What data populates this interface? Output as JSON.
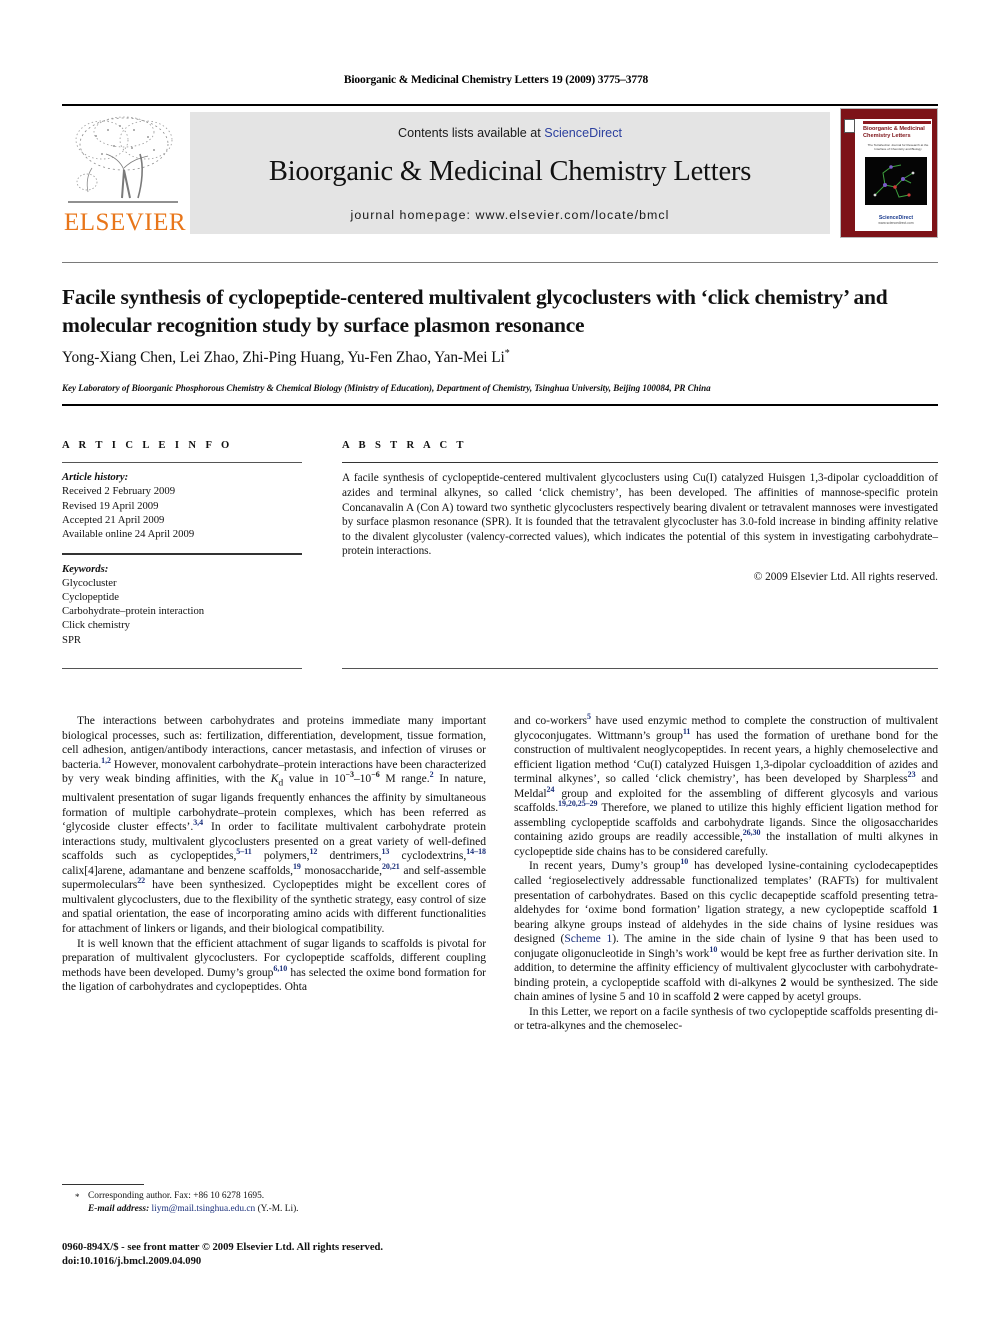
{
  "running_head": "Bioorganic & Medicinal Chemistry Letters 19 (2009) 3775–3778",
  "masthead": {
    "contents_prefix": "Contents lists available at ",
    "sciencedirect": "ScienceDirect",
    "journal_title": "Bioorganic & Medicinal Chemistry Letters",
    "homepage": "journal homepage: www.elsevier.com/locate/bmcl",
    "publisher_logo_text": "ELSEVIER",
    "cover": {
      "title": "Bioorganic & Medicinal Chemistry Letters",
      "subtitle": "The Tetrahedron Journal for Research at the Interface of Chemistry and Biology",
      "footer": "ScienceDirect",
      "footer_url": "www.sciencedirect.com",
      "border_color": "#7d1318"
    }
  },
  "article": {
    "title": "Facile synthesis of cyclopeptide-centered multivalent glycoclusters with ‘click chemistry’ and molecular recognition study by surface plasmon resonance",
    "authors": "Yong-Xiang Chen, Lei Zhao, Zhi-Ping Huang, Yu-Fen Zhao, Yan-Mei Li",
    "author_marker": "*",
    "affiliation": "Key Laboratory of Bioorganic Phosphorous Chemistry & Chemical Biology (Ministry of Education), Department of Chemistry, Tsinghua University, Beijing 100084, PR China"
  },
  "article_info": {
    "heading": "A R T I C L E   I N F O",
    "history_label": "Article history:",
    "history": [
      "Received 2 February 2009",
      "Revised 19 April 2009",
      "Accepted 21 April 2009",
      "Available online 24 April 2009"
    ],
    "keywords_label": "Keywords:",
    "keywords": [
      "Glycocluster",
      "Cyclopeptide",
      "Carbohydrate–protein interaction",
      "Click chemistry",
      "SPR"
    ]
  },
  "abstract": {
    "heading": "A B S T R A C T",
    "text": "A facile synthesis of cyclopeptide-centered multivalent glycoclusters using Cu(I) catalyzed Huisgen 1,3-dipolar cycloaddition of azides and terminal alkynes, so called ‘click chemistry’, has been developed. The affinities of mannose-specific protein Concanavalin A (Con A) toward two synthetic glycoclusters respectively bearing divalent or tetravalent mannoses were investigated by surface plasmon resonance (SPR). It is founded that the tetravalent glycocluster has 3.0-fold increase in binding affinity relative to the divalent glycoluster (valency-corrected values), which indicates the potential of this system in investigating carbohydrate–protein interactions.",
    "copyright": "© 2009 Elsevier Ltd. All rights reserved."
  },
  "body": {
    "left_paragraphs": [
      "The interactions between carbohydrates and proteins immediate many important biological processes, such as: fertilization, differentiation, development, tissue formation, cell adhesion, antigen/antibody interactions, cancer metastasis, and infection of viruses or bacteria.[1,2] However, monovalent carbohydrate–protein interactions have been characterized by very weak binding affinities, with the Kd value in 10^-3–10^-6 M range.[2] In nature, multivalent presentation of sugar ligands frequently enhances the affinity by simultaneous formation of multiple carbohydrate–protein complexes, which has been referred as ‘glycoside cluster effects’.[3,4] In order to facilitate multivalent carbohydrate protein interactions study, multivalent glycoclusters presented on a great variety of well-defined scaffolds such as cyclopeptides,[5–11] polymers,[12] dentrimers,[13] cyclodextrins,[14–18] calix[4]arene, adamantane and benzene scaffolds,[19] monosaccharide,[20,21] and self-assemble supermoleculars[22] have been synthesized. Cyclopeptides might be excellent cores of multivalent glycoclusters, due to the flexibility of the synthetic strategy, easy control of size and spatial orientation, the ease of incorporating amino acids with different functionalities for attachment of linkers or ligands, and their biological compatibility.",
      "It is well known that the efficient attachment of sugar ligands to scaffolds is pivotal for preparation of multivalent glycoclusters. For cyclopeptide scaffolds, different coupling methods have been developed. Dumy’s group[6,10] has selected the oxime bond formation for the ligation of carbohydrates and cyclopeptides. Ohta"
    ],
    "right_paragraphs": [
      "and co-workers[5] have used enzymic method to complete the construction of multivalent glycoconjugates. Wittmann’s group[11] has used the formation of urethane bond for the construction of multivalent neoglycopeptides. In recent years, a highly chemoselective and efficient ligation method ‘Cu(I) catalyzed Huisgen 1,3-dipolar cycloaddition of azides and terminal alkynes’, so called ‘click chemistry’, has been developed by Sharpless[23] and Meldal[24] group and exploited for the assembling of different glycosyls and various scaffolds.[19,20,25–29] Therefore, we planed to utilize this highly efficient ligation method for assembling cyclopeptide scaffolds and carbohydrate ligands. Since the oligosaccharides containing azido groups are readily accessible,[26,30] the installation of multi alkynes in cyclopeptide side chains has to be considered carefully.",
      "In recent years, Dumy’s group[10] has developed lysine-containing cyclodecapeptides called ‘regioselectively addressable functionalized templates’ (RAFTs) for multivalent presentation of carbohydrates. Based on this cyclic decapeptide scaffold presenting tetra-aldehydes for ‘oxime bond formation’ ligation strategy, a new cyclopeptide scaffold 1 bearing alkyne groups instead of aldehydes in the side chains of lysine residues was designed (Scheme 1). The amine in the side chain of lysine 9 that has been used to conjugate oligonucleotide in Singh’s work[10] would be kept free as further derivation site. In addition, to determine the affinity efficiency of multivalent glycocluster with carbohydrate-binding protein, a cyclopeptide scaffold with di-alkynes 2 would be synthesized. The side chain amines of lysine 5 and 10 in scaffold 2 were capped by acetyl groups.",
      "In this Letter, we report on a facile synthesis of two cyclopeptide scaffolds presenting di- or tetra-alkynes and the chemoselec-"
    ]
  },
  "footnote": {
    "marker": "*",
    "line1": "Corresponding author. Fax: +86 10 6278 1695.",
    "email_label": "E-mail address:",
    "email": "liym@mail.tsinghua.edu.cn",
    "email_suffix": "(Y.-M. Li)."
  },
  "issn": {
    "line1": "0960-894X/$ - see front matter © 2009 Elsevier Ltd. All rights reserved.",
    "line2": "doi:10.1016/j.bmcl.2009.04.090"
  },
  "colors": {
    "accent_link": "#1a2f7a",
    "elsevier_orange": "#E8761A",
    "band_gray": "#e4e4e4",
    "cover_maroon": "#7d1318"
  }
}
